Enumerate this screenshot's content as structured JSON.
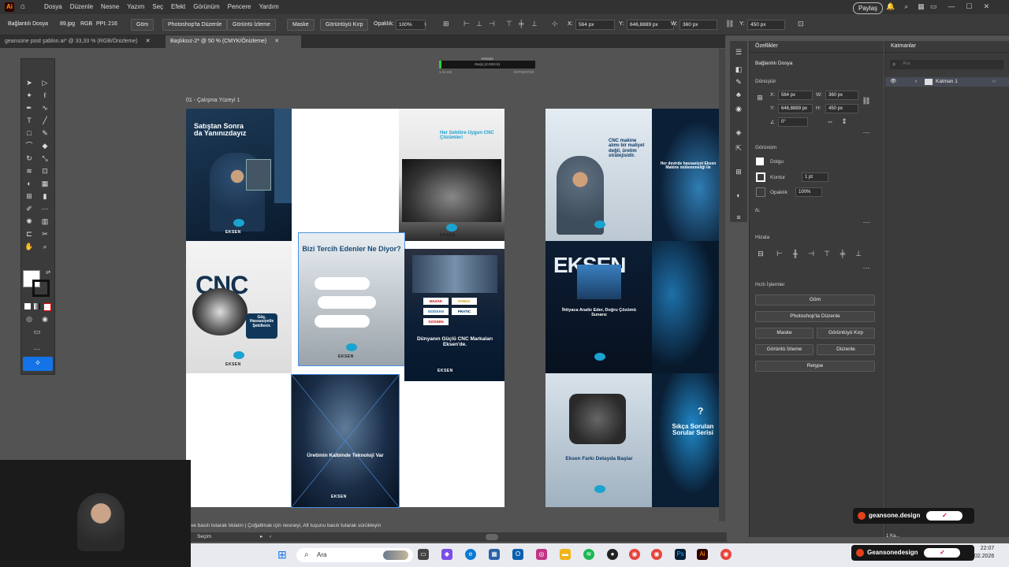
{
  "app": {
    "logo": "Ai"
  },
  "menubar": {
    "items": [
      "Dosya",
      "Düzenle",
      "Nesne",
      "Yazım",
      "Seç",
      "Efekt",
      "Görünüm",
      "Pencere",
      "Yardım"
    ],
    "share_label": "Paylaş"
  },
  "control_bar": {
    "linked_file": "Bağlantılı Dosya",
    "file_name": "89.jpg",
    "color_mode": "RGB",
    "ppi": "PPI: 216",
    "embed": "Göm",
    "edit_photoshop": "Photoshop'ta Düzenle",
    "image_trace": "Görüntü İzleme",
    "mask": "Maske",
    "crop_image": "Görüntüyü Kırp",
    "opacity_label": "Opaklık:",
    "opacity_value": "100%",
    "x_label": "X:",
    "x_value": "564 px",
    "y_label": "Y:",
    "y_value": "646,8889 px",
    "w_label": "W:",
    "w_value": "360 px",
    "h_label": "Y:",
    "h_value": "450 px"
  },
  "tabs": [
    {
      "label": "geansone post şablon.ai* @ 33,33 % (RGB/Önizleme)"
    },
    {
      "label": "Başlıksız-2* @ 50 % (CMYK/Önizleme)"
    }
  ],
  "canvas": {
    "artboard_label": "01 - Çalışma Yüzeyi 1",
    "progress_top": "Yerleştir",
    "progress_mid": "Geçiş (2.02/4.5)",
    "progress_left": "1.51 KB",
    "progress_right": "ESTIMATED",
    "tiles": {
      "t1_title": "Satıştan Sonra da Yanınızdayız",
      "t2_title": "Her Sektöre Uygun CNC Çözümleri",
      "t3_title": "CNC",
      "t3_sub": "Güç, Hassasiyetle Şekillenir.",
      "t4_title": "Bizi Tercih Edenler Ne Diyor?",
      "t5_title": "Dünyanın Güçlü CNC Markaları Eksen'de.",
      "t5_logos": [
        "MAZAK",
        "FANUC",
        "DOOSAN",
        "PRATIC",
        "GOSSEN"
      ],
      "t6_title": "Üretimin Kalbinde Teknoloji Var",
      "brand": "EKSEN",
      "r1_title": "CNC makine alımı bir maliyet değil, üretim stratejisidir.",
      "r2_title": "Her devirde hassasiyet Eksen Makine mükemmeliği ile",
      "r3_title": "EKSEN",
      "r3_sub": "İhtiyaca Analiz Eder, Doğru Çözümü Sunarız",
      "r4_title": "Eksen Farkı Detayda Başlar",
      "r5_mark": "?",
      "r5_title": "Sıkça Sorulan Sorular Serisi"
    }
  },
  "properties_panel": {
    "tab": "Özellikler",
    "section_linked": "Bağlantılı Dosya",
    "section_transform": "Dönüştür",
    "x": "564 px",
    "y": "646,8889 px",
    "w": "360 px",
    "h": "450 px",
    "angle": "0°",
    "section_appearance": "Görünüm",
    "fill": "Dolgu",
    "stroke": "Kontur",
    "stroke_value": "1 pt",
    "opacity": "Opaklık",
    "opacity_value": "100%",
    "fx": "fx.",
    "section_align": "Hizala",
    "section_quick": "Hızlı İşlemler",
    "btn_embed": "Göm",
    "btn_edit_ps": "Photoshop'ta Düzenle",
    "btn_mask": "Maske",
    "btn_crop": "Görüntüyü Kırp",
    "btn_trace": "Görüntü İzleme",
    "btn_arrange": "Düzenle",
    "btn_retype": "Retype"
  },
  "layers_panel": {
    "tab": "Katmanlar",
    "search_placeholder": "Ara",
    "layer1": "Katman 1"
  },
  "status": {
    "hint": "ve basılı tutarak tıklatın | Çoğaltmak için nesneyi, Alt tuşunu basılı tutarak sürükleyin",
    "tool": "Seçim",
    "layer_count": "1 Ka..."
  },
  "taskbar": {
    "search": "Ara",
    "time": "22:07",
    "date": "02.2026"
  },
  "overlays": {
    "watermark1": "geansone.design",
    "watermark2": "Geansonedesign"
  },
  "colors": {
    "accent": "#1aa3d1",
    "dark_navy": "#0d1e33",
    "ui_bg": "#535353"
  }
}
